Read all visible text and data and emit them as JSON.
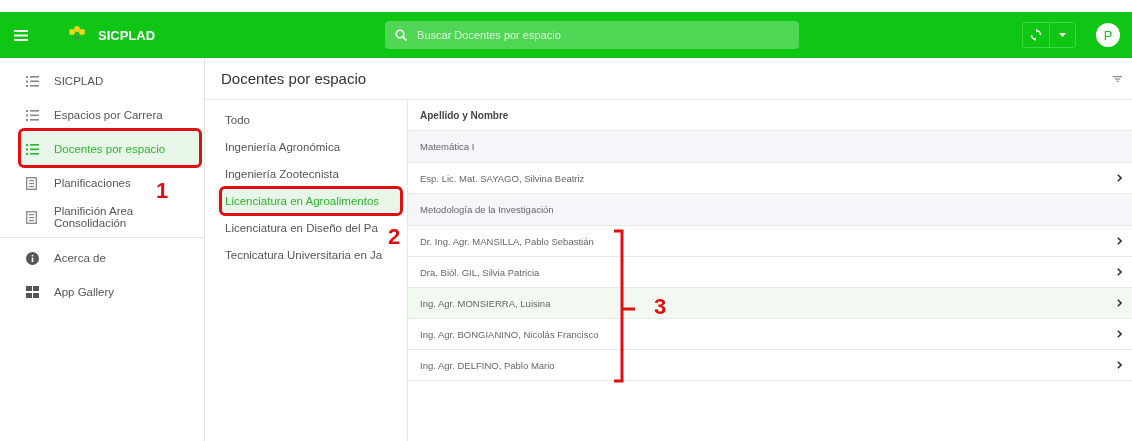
{
  "app": {
    "title": "SICPLAD"
  },
  "search": {
    "placeholder": "Buscar Docentes por espacio"
  },
  "user": {
    "initial": "P"
  },
  "sidebar": {
    "items": [
      {
        "label": "SICPLAD",
        "kind": "list",
        "selected": false
      },
      {
        "label": "Espacios por Carrera",
        "kind": "list",
        "selected": false
      },
      {
        "label": "Docentes por espacio",
        "kind": "list",
        "selected": true
      },
      {
        "label": "Planificaciones",
        "kind": "doc",
        "selected": false
      },
      {
        "label": "Planifición Area Consolidación",
        "kind": "doc",
        "selected": false
      }
    ],
    "footer_items": [
      {
        "label": "Acerca de",
        "kind": "info",
        "selected": false
      },
      {
        "label": "App Gallery",
        "kind": "grid",
        "selected": false
      }
    ]
  },
  "page": {
    "title": "Docentes por espacio"
  },
  "carreras": [
    {
      "label": "Todo",
      "selected": false
    },
    {
      "label": "Ingeniería Agronómica",
      "selected": false
    },
    {
      "label": "Ingeniería Zootecnista",
      "selected": false
    },
    {
      "label": "Licenciatura en Agroalimentos",
      "selected": true
    },
    {
      "label": "Licenciatura en Diseño del Pa",
      "selected": false
    },
    {
      "label": "Tecnicatura Universitaria en Ja",
      "selected": false
    }
  ],
  "table": {
    "columns": [
      "Apellido y Nombre"
    ],
    "rows": [
      {
        "kind": "group",
        "text": "Matemática I"
      },
      {
        "kind": "teacher",
        "text": "Esp. Lic. Mat. SAYAGO, Silvina Beatriz",
        "selected": false
      },
      {
        "kind": "group",
        "text": "Metodología de la Investigación"
      },
      {
        "kind": "teacher",
        "text": "Dr. Ing. Agr. MANSILLA, Pablo Sebastián",
        "selected": false
      },
      {
        "kind": "teacher",
        "text": "Dra. Biól. GIL, Silvia Patricia",
        "selected": false
      },
      {
        "kind": "teacher",
        "text": "Ing. Agr. MONSIERRA, Luisina",
        "selected": true
      },
      {
        "kind": "teacher",
        "text": "Ing. Agr. BONGIANINO, Nicolás Francisco",
        "selected": false
      },
      {
        "kind": "teacher",
        "text": "Ing. Agr. DELFINO, Pablo Mario",
        "selected": false
      }
    ]
  },
  "annotations": [
    {
      "label": "1"
    },
    {
      "label": "2"
    },
    {
      "label": "3"
    }
  ]
}
